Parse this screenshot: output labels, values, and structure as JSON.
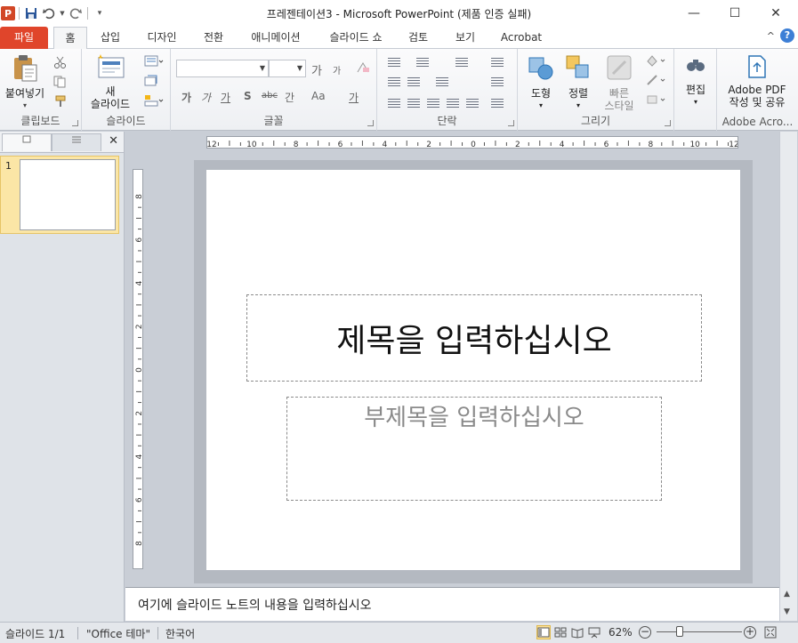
{
  "window": {
    "title": "프레젠테이션3  -  Microsoft PowerPoint (제품 인증 실패)",
    "app_icon": "P",
    "minimize": "—",
    "maximize": "☐",
    "close": "✕"
  },
  "tabs": [
    {
      "label": "파일"
    },
    {
      "label": "홈"
    },
    {
      "label": "삽입"
    },
    {
      "label": "디자인"
    },
    {
      "label": "전환"
    },
    {
      "label": "애니메이션"
    },
    {
      "label": "슬라이드 쇼"
    },
    {
      "label": "검토"
    },
    {
      "label": "보기"
    },
    {
      "label": "Acrobat"
    }
  ],
  "help": "?",
  "ribbon": {
    "clipboard": {
      "paste": "붙여넣기",
      "label": "클립보드"
    },
    "slides": {
      "new_line1": "새",
      "new_line2": "슬라이드",
      "label": "슬라이드"
    },
    "font": {
      "label": "글꼴",
      "grow": "가",
      "shrink": "가",
      "bold": "가",
      "italic": "가",
      "underline": "가",
      "shadow": "S",
      "strike": "abc",
      "spacing": "간",
      "case": "Aa",
      "color": "가"
    },
    "paragraph": {
      "label": "단락"
    },
    "drawing": {
      "shapes": "도형",
      "arrange": "정렬",
      "quick_styles_1": "빠른",
      "quick_styles_2": "스타일",
      "label": "그리기"
    },
    "editing": {
      "edit": "편집"
    },
    "adobe": {
      "line1": "Adobe PDF",
      "line2": "작성 및 공유",
      "label": "Adobe Acro..."
    }
  },
  "slides_panel": {
    "slide_number": "1",
    "close": "✕"
  },
  "ruler": {
    "h_labels": [
      "12",
      "10",
      "8",
      "6",
      "4",
      "2",
      "0",
      "2",
      "4",
      "6",
      "8",
      "10",
      "12"
    ],
    "v_labels": [
      "8",
      "6",
      "4",
      "2",
      "0",
      "2",
      "4",
      "6",
      "8"
    ]
  },
  "slide": {
    "title_placeholder": "제목을 입력하십시오",
    "subtitle_placeholder": "부제목을 입력하십시오"
  },
  "notes": {
    "placeholder": "여기에 슬라이드 노트의 내용을 입력하십시오"
  },
  "status": {
    "slide": "슬라이드 1/1",
    "theme": "\"Office 테마\"",
    "language": "한국어",
    "zoom": "62%",
    "zoom_level": 0.62,
    "minus": "−",
    "plus": "+"
  },
  "colors": {
    "file_tab": "#e0452b",
    "help": "#3d7fd6",
    "accent": "#fde39b"
  }
}
